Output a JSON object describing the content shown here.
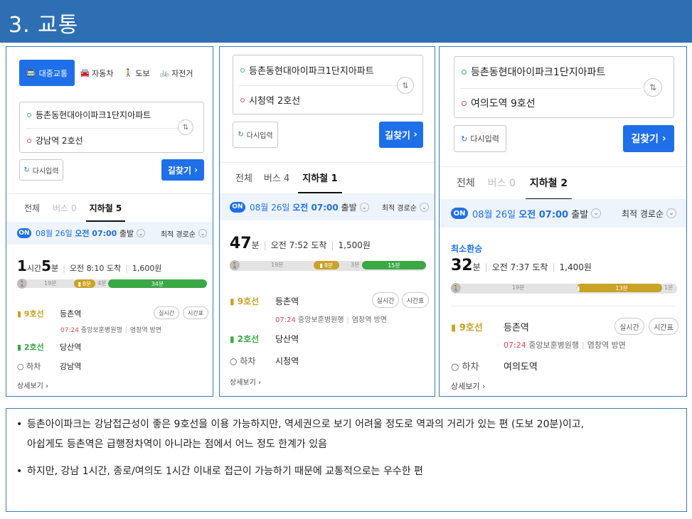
{
  "slide_title": "3. 교통",
  "panel1": {
    "modes": [
      "대중교통",
      "자동차",
      "도보",
      "자전거"
    ],
    "origin": "등촌동현대아이파크1단지아파트",
    "destination": "강남역 2호선",
    "reset_label": "다시입력",
    "go_label": "길찾기",
    "tabs": [
      "전체",
      "버스 0",
      "지하철 5"
    ],
    "on_badge": "ON",
    "date_prefix": "08월 26일 ",
    "date_bold": "오전 07:00",
    "date_suffix": " 출발",
    "sort_label": "최적 경로순",
    "duration_h": "1",
    "duration_h_unit": "시간 ",
    "duration_m": "5",
    "duration_m_unit": "분",
    "arrival": "오전 8:10 도착",
    "fare": "1,600원",
    "bar": {
      "walk1": "19분",
      "seg1": "8분",
      "gap": "4분",
      "seg2": "34분"
    },
    "stops": [
      {
        "line": "9호선",
        "name": "등촌역"
      },
      {
        "line": "2호선",
        "name": "당산역"
      },
      {
        "line": "하차",
        "name": "강남역"
      }
    ],
    "sub_time": "07:24",
    "sub_dir": "중앙보훈병원행",
    "sub_exit": "염창역 방면",
    "realtime": "실시간",
    "timetable": "시간표",
    "more": "상세보기"
  },
  "panel2": {
    "origin": "등촌동현대아이파크1단지아파트",
    "destination": "시청역 2호선",
    "reset_label": "다시입력",
    "go_label": "길찾기",
    "tabs": [
      "전체",
      "버스 4",
      "지하철 1"
    ],
    "on_badge": "ON",
    "date_prefix": "08월 26일 ",
    "date_bold": "오전 07:00",
    "date_suffix": " 출발",
    "sort_label": "최적 경로순",
    "duration_m": "47",
    "duration_m_unit": "분",
    "arrival": "오전 7:52 도착",
    "fare": "1,500원",
    "bar": {
      "walk1": "19분",
      "seg1": "8분",
      "gap": "3분",
      "seg2": "15분"
    },
    "stops": [
      {
        "line": "9호선",
        "name": "등촌역"
      },
      {
        "line": "2호선",
        "name": "당산역"
      },
      {
        "line": "하차",
        "name": "시청역"
      }
    ],
    "sub_time": "07:24",
    "sub_dir": "중앙보훈병원행",
    "sub_exit": "염창역 방면",
    "realtime": "실시간",
    "timetable": "시간표",
    "more": "상세보기"
  },
  "panel3": {
    "origin": "등촌동현대아이파크1단지아파트",
    "destination": "여의도역 9호선",
    "reset_label": "다시입력",
    "go_label": "길찾기",
    "tabs": [
      "전체",
      "버스 0",
      "지하철 2"
    ],
    "on_badge": "ON",
    "date_prefix": "08월 26일 ",
    "date_bold": "오전 07:00",
    "date_suffix": " 출발",
    "sort_label": "최적 경로순",
    "label_min_transfer": "최소환승",
    "duration_m": "32",
    "duration_m_unit": "분",
    "arrival": "오전 7:37 도착",
    "fare": "1,400원",
    "bar": {
      "walk1": "19분",
      "seg1": "13분",
      "walk2": "1분"
    },
    "stops": [
      {
        "line": "9호선",
        "name": "등촌역"
      },
      {
        "line": "하차",
        "name": "여의도역"
      }
    ],
    "sub_time": "07:24",
    "sub_dir": "중앙보훈병원행",
    "sub_exit": "염창역 방면",
    "realtime": "실시간",
    "timetable": "시간표",
    "more": "상세보기"
  },
  "notes": [
    "등촌아이파크는 강남접근성이 좋은 9호선을 이용 가능하지만, 역세권으로 보기 어려울 정도로 역과의 거리가 있는 편 (도보 20분)이고,",
    "아쉽게도 등촌역은 급행정차역이 아니라는 점에서 어느 정도 한계가 있음",
    "하지만, 강남 1시간, 종로/여의도 1시간 이내로 접근이 가능하기 때문에 교통적으로는 우수한 편"
  ],
  "colors": {
    "line9": "#c9a227",
    "line2": "#3aa845",
    "accent": "#1e6fe8",
    "slide": "#2e6fb3"
  }
}
